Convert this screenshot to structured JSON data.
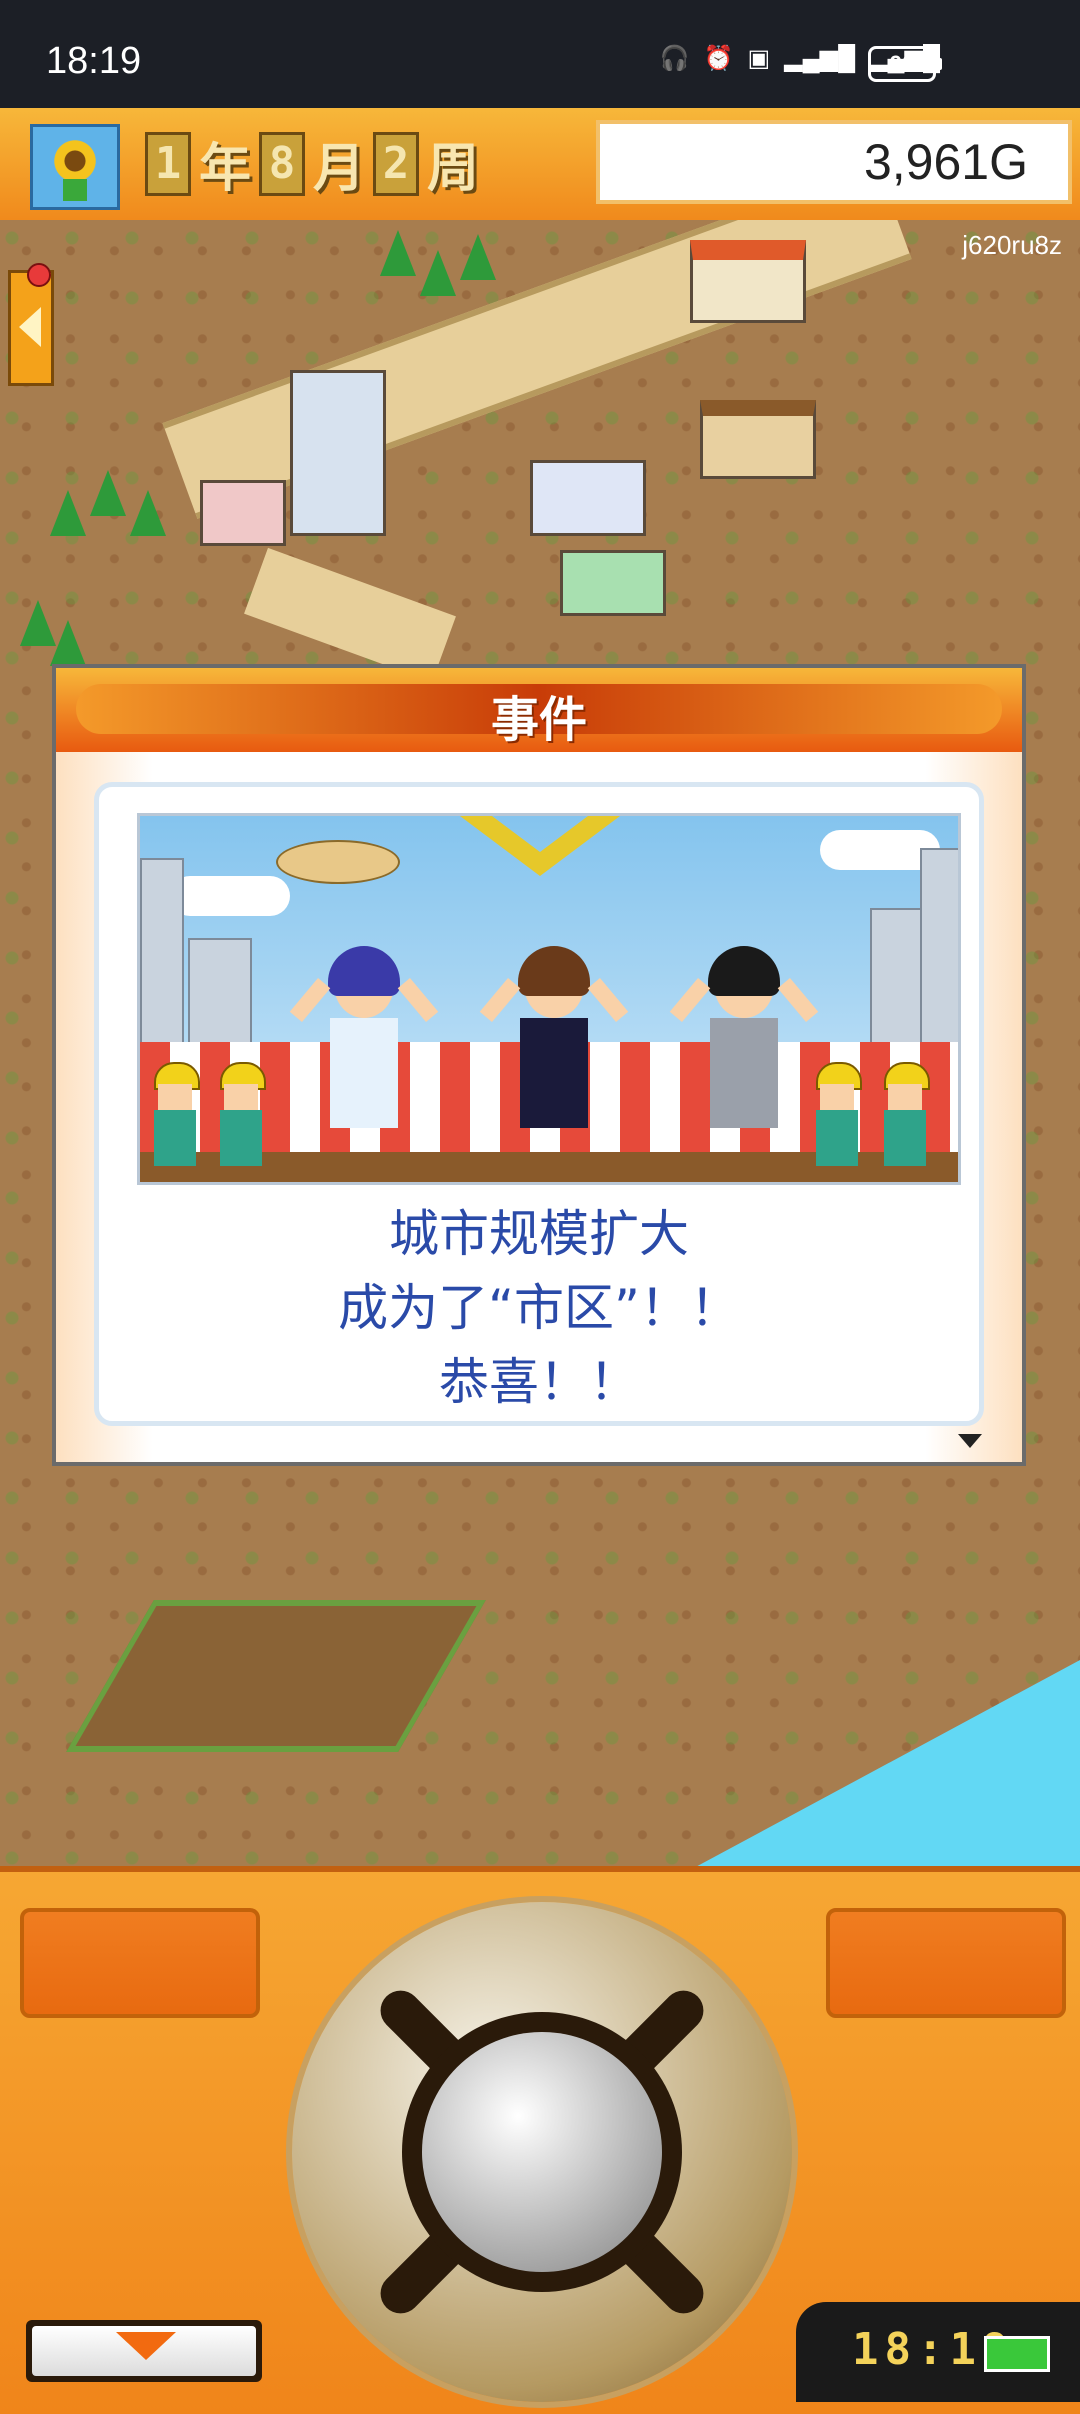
{
  "status_bar": {
    "time": "18:19",
    "icons": [
      "headphones-icon",
      "alarm-icon",
      "hd-icon",
      "5g-signal-icon",
      "4g-signal-icon"
    ],
    "battery": "90"
  },
  "hud": {
    "year_num": "1",
    "year_unit": "年",
    "month_num": "8",
    "month_unit": "月",
    "week_num": "2",
    "week_unit": "周",
    "gold": "3,961G"
  },
  "map": {
    "watermark": "j620ru8z"
  },
  "event": {
    "title": "事件",
    "lines": [
      "城市规模扩大",
      "成为了“市区”！！",
      "恭喜！！"
    ]
  },
  "panel": {
    "clock": "18:19"
  },
  "colors": {
    "accent_orange": "#f08a1c",
    "message_blue": "#2a4aa8",
    "water": "#62d8f4"
  }
}
